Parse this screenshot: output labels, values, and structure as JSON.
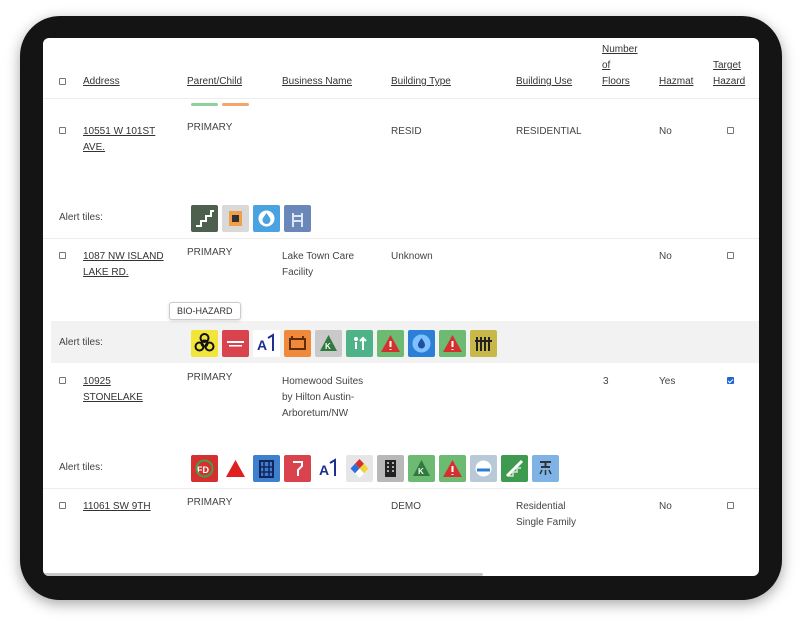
{
  "table": {
    "headers": {
      "address": "Address",
      "parent_child": "Parent/Child",
      "business_name": "Business Name",
      "building_type": "Building Type",
      "building_use": "Building Use",
      "floors": [
        "Number",
        "of",
        "Floors"
      ],
      "hazmat": "Hazmat",
      "target_hazard": [
        "Target",
        "Hazard"
      ]
    },
    "legend_colors": [
      "#8fd19e",
      "#f4a56a"
    ],
    "alert_label": "Alert tiles:",
    "rows": [
      {
        "address": [
          "10551 W 101ST",
          "AVE."
        ],
        "parent_child": "PRIMARY",
        "business_name": [],
        "building_type": "RESID",
        "building_use": [
          "RESIDENTIAL"
        ],
        "floors": "",
        "hazmat": "No",
        "target_hazard": false,
        "tiles": [
          {
            "icon": "stairs-icon",
            "bg": "#4d5f4d"
          },
          {
            "icon": "fire-panel-icon",
            "bg": "#d9d9d9"
          },
          {
            "icon": "water-supply-icon",
            "bg": "#4aa3e0"
          },
          {
            "icon": "standpipe-icon",
            "bg": "#6b86b8"
          }
        ]
      },
      {
        "address": [
          "1087 NW ISLAND",
          "LAKE RD."
        ],
        "parent_child": "PRIMARY",
        "business_name": [
          "Lake Town Care",
          "Facility"
        ],
        "building_type": "Unknown",
        "building_use": [],
        "floors": "",
        "hazmat": "No",
        "target_hazard": false,
        "tiles": [
          {
            "icon": "bio-hazard-icon",
            "bg": "#f2e53a"
          },
          {
            "icon": "fire-control-room-icon",
            "bg": "#d8434e"
          },
          {
            "icon": "fire-department-connection-icon",
            "bg": "#ffffff"
          },
          {
            "icon": "alarm-panel-icon",
            "bg": "#f08a3a"
          },
          {
            "icon": "knox-box-icon",
            "bg": "#c9c9c9"
          },
          {
            "icon": "elevator-icon",
            "bg": "#4fb38a"
          },
          {
            "icon": "warning-icon",
            "bg": "#6dbb72"
          },
          {
            "icon": "sprinkler-icon",
            "bg": "#2c7fd6"
          },
          {
            "icon": "warning-icon",
            "bg": "#6dbb72"
          },
          {
            "icon": "gate-icon",
            "bg": "#c8b84a"
          }
        ]
      },
      {
        "address": [
          "10925",
          "STONELAKE"
        ],
        "parent_child": "PRIMARY",
        "business_name": [
          "Homewood Suites",
          "by Hilton Austin-",
          "Arboretum/NW"
        ],
        "building_type": "",
        "building_use": [],
        "floors": "3",
        "hazmat": "Yes",
        "target_hazard": true,
        "tiles": [
          {
            "icon": "fire-department-icon",
            "bg": "#d62f2f"
          },
          {
            "icon": "hazard-triangle-icon",
            "bg": "#ffffff"
          },
          {
            "icon": "building-windows-icon",
            "bg": "#3e7fcf"
          },
          {
            "icon": "alarm-pull-icon",
            "bg": "#d8434e"
          },
          {
            "icon": "fire-department-connection-icon",
            "bg": "#ffffff"
          },
          {
            "icon": "hazmat-diamond-icon",
            "bg": "#e6e6e6"
          },
          {
            "icon": "high-rise-icon",
            "bg": "#b8b8b8"
          },
          {
            "icon": "knox-box-icon",
            "bg": "#6dbb72"
          },
          {
            "icon": "warning-icon",
            "bg": "#6dbb72"
          },
          {
            "icon": "hydrant-icon",
            "bg": "#b9c9d8"
          },
          {
            "icon": "stairwell-icon",
            "bg": "#3e9a4e"
          },
          {
            "icon": "sprinkler-head-icon",
            "bg": "#7fb3e6"
          }
        ]
      },
      {
        "address": [
          "11061 SW 9TH"
        ],
        "parent_child": "PRIMARY",
        "business_name": [],
        "building_type": "DEMO",
        "building_use": [
          "Residential",
          "Single Family"
        ],
        "floors": "",
        "hazmat": "No",
        "target_hazard": false,
        "tiles": []
      }
    ]
  },
  "tooltip": {
    "text": "BIO-HAZARD"
  }
}
